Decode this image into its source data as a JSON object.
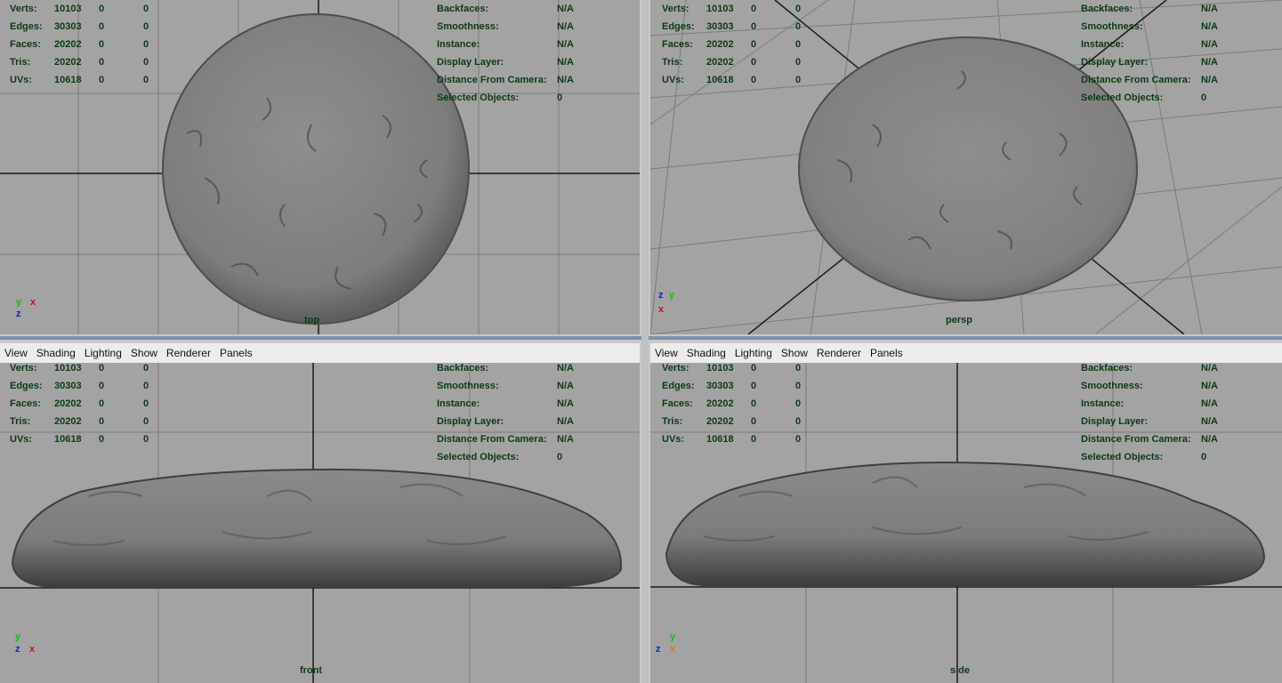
{
  "menu": [
    "View",
    "Shading",
    "Lighting",
    "Show",
    "Renderer",
    "Panels"
  ],
  "hud_left": {
    "rows": [
      {
        "label": "Verts:",
        "v1": "10103",
        "v2": "0",
        "v3": "0"
      },
      {
        "label": "Edges:",
        "v1": "30303",
        "v2": "0",
        "v3": "0"
      },
      {
        "label": "Faces:",
        "v1": "20202",
        "v2": "0",
        "v3": "0"
      },
      {
        "label": "Tris:",
        "v1": "20202",
        "v2": "0",
        "v3": "0"
      },
      {
        "label": "UVs:",
        "v1": "10618",
        "v2": "0",
        "v3": "0"
      }
    ]
  },
  "hud_right": {
    "rows": [
      {
        "label": "Backfaces:",
        "value": "N/A"
      },
      {
        "label": "Smoothness:",
        "value": "N/A"
      },
      {
        "label": "Instance:",
        "value": "N/A"
      },
      {
        "label": "Display Layer:",
        "value": "N/A"
      },
      {
        "label": "Distance From Camera:",
        "value": "N/A"
      },
      {
        "label": "Selected Objects:",
        "value": "0"
      }
    ]
  },
  "cameras": {
    "top": "top",
    "persp": "persp",
    "front": "front",
    "side": "side"
  },
  "axis_labels": {
    "x": "x",
    "y": "y",
    "z": "z"
  },
  "colors": {
    "viewport_bg": "#a3a3a3",
    "grid_line": "#7b7b7b",
    "grid_axis": "#1a1a1a",
    "hud_text": "#0c3a12",
    "menubar_bg": "#ececec",
    "axis_x": "#d01010",
    "axis_y": "#10c010",
    "axis_z": "#1020d0"
  }
}
